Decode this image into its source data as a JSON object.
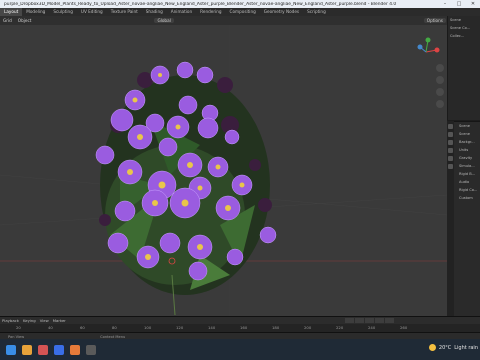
{
  "window": {
    "title": "purple_Dropbox3D_Model_Plants_Ready_to_Upload_Aster_novae-angliae_New_England_Aster_purple_Blender_Aster_novae-angliae_New_England_Aster_purple.blend - Blender 4.0"
  },
  "workspaces": [
    "Layout",
    "Modeling",
    "Sculpting",
    "UV Editing",
    "Texture Paint",
    "Shading",
    "Animation",
    "Rendering",
    "Compositing",
    "Geometry Nodes",
    "Scripting"
  ],
  "viewport_header": {
    "mode": "Grid",
    "menu_object": "Object",
    "transform": "Global",
    "options": "Options"
  },
  "outliner": {
    "title": "Scene",
    "items": [
      "Scene Co...",
      "Collec..."
    ]
  },
  "properties": {
    "sections": [
      "Scene",
      "Scene",
      "Backgr...",
      "Units",
      "Gravity",
      "Simula...",
      "Rigid B...",
      "Audio",
      "Rigid Co...",
      "Custom"
    ]
  },
  "timeline": {
    "menus": [
      "Playback",
      "Keying",
      "View",
      "Marker"
    ],
    "ticks": [
      "20",
      "40",
      "60",
      "80",
      "100",
      "120",
      "140",
      "160",
      "180",
      "200",
      "220",
      "240",
      "260"
    ]
  },
  "statusbar": {
    "items": [
      "Pan View",
      "Context Menu"
    ]
  },
  "taskbar": {
    "weather_temp": "20°C",
    "weather_text": "Light rain"
  }
}
